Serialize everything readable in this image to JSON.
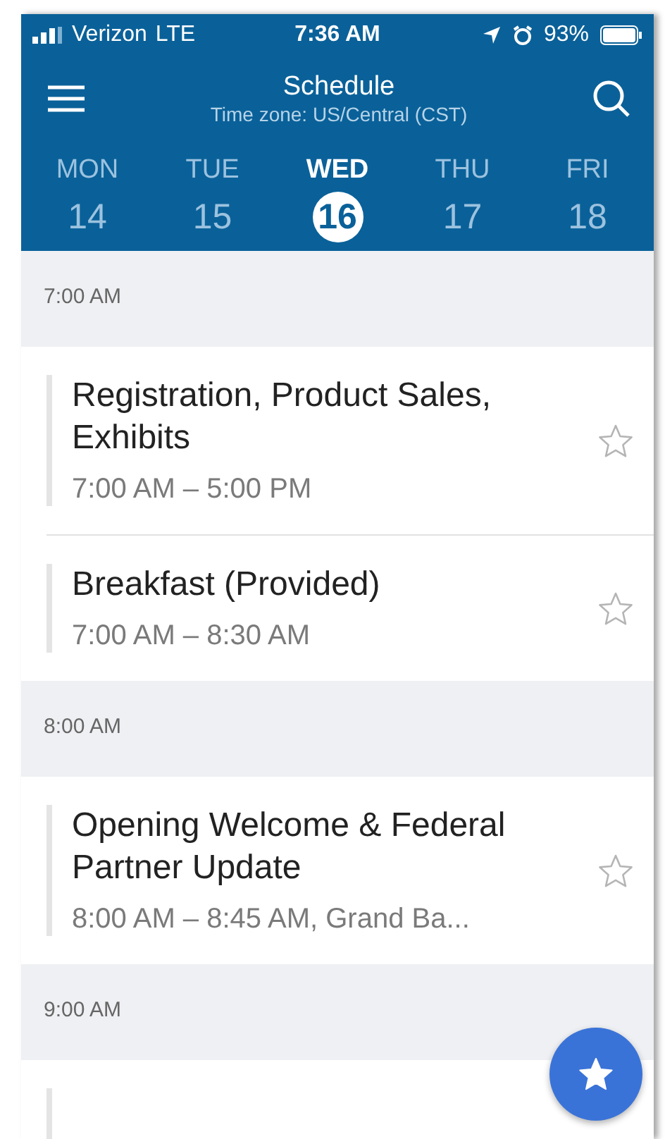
{
  "status_bar": {
    "carrier": "Verizon",
    "network": "LTE",
    "time": "7:36 AM",
    "battery": "93%"
  },
  "header": {
    "title": "Schedule",
    "subtitle": "Time zone: US/Central (CST)"
  },
  "days": [
    {
      "label": "MON",
      "number": "14",
      "selected": false
    },
    {
      "label": "TUE",
      "number": "15",
      "selected": false
    },
    {
      "label": "WED",
      "number": "16",
      "selected": true
    },
    {
      "label": "THU",
      "number": "17",
      "selected": false
    },
    {
      "label": "FRI",
      "number": "18",
      "selected": false
    }
  ],
  "sections": [
    {
      "time": "7:00 AM",
      "events": [
        {
          "title": "Registration, Product Sales, Exhibits",
          "time": "7:00 AM – 5:00 PM",
          "starred": false
        },
        {
          "title": "Breakfast (Provided)",
          "time": "7:00 AM – 8:30 AM",
          "starred": false
        }
      ]
    },
    {
      "time": "8:00 AM",
      "events": [
        {
          "title": "Opening Welcome & Federal Partner Update",
          "time": "8:00 AM – 8:45 AM,  Grand Ba...",
          "starred": false
        }
      ]
    },
    {
      "time": "9:00 AM"
    }
  ]
}
